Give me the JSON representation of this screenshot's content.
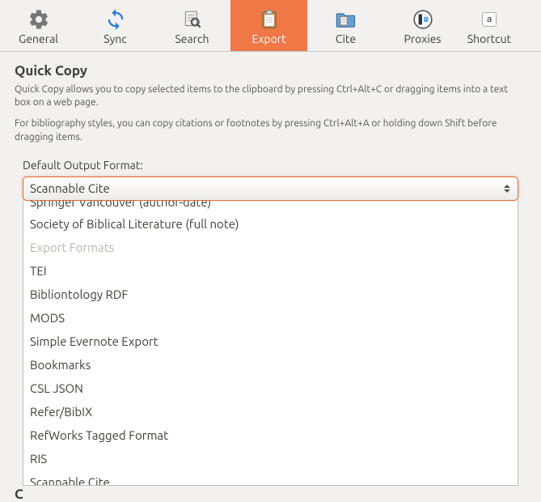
{
  "toolbar": {
    "active_index": 3,
    "items": [
      {
        "label": "General"
      },
      {
        "label": "Sync"
      },
      {
        "label": "Search"
      },
      {
        "label": "Export"
      },
      {
        "label": "Cite"
      },
      {
        "label": "Proxies"
      },
      {
        "label": "Shortcut"
      }
    ]
  },
  "section": {
    "title": "Quick Copy",
    "help1": "Quick Copy allows you to copy selected items to the clipboard by pressing Ctrl+Alt+C or dragging items into a text box on a web page.",
    "help2": "For bibliography styles, you can copy citations or footnotes by pressing Ctrl+Alt+A or holding down Shift before dragging items.",
    "field_label": "Default Output Format:",
    "selected_value": "Scannable Cite"
  },
  "dropdown": {
    "cutoff_item": "Springer Vancouver (author-date)",
    "groups": [
      {
        "header": null,
        "items": [
          "Society of Biblical Literature (full note)"
        ]
      },
      {
        "header": "Export Formats",
        "items": [
          "TEI",
          "Bibliontology RDF",
          "MODS",
          "Simple Evernote Export",
          "Bookmarks",
          "CSL JSON",
          "Refer/BibIX",
          "RefWorks Tagged Format",
          "RIS",
          "Scannable Cite"
        ]
      }
    ]
  },
  "peek": "C"
}
